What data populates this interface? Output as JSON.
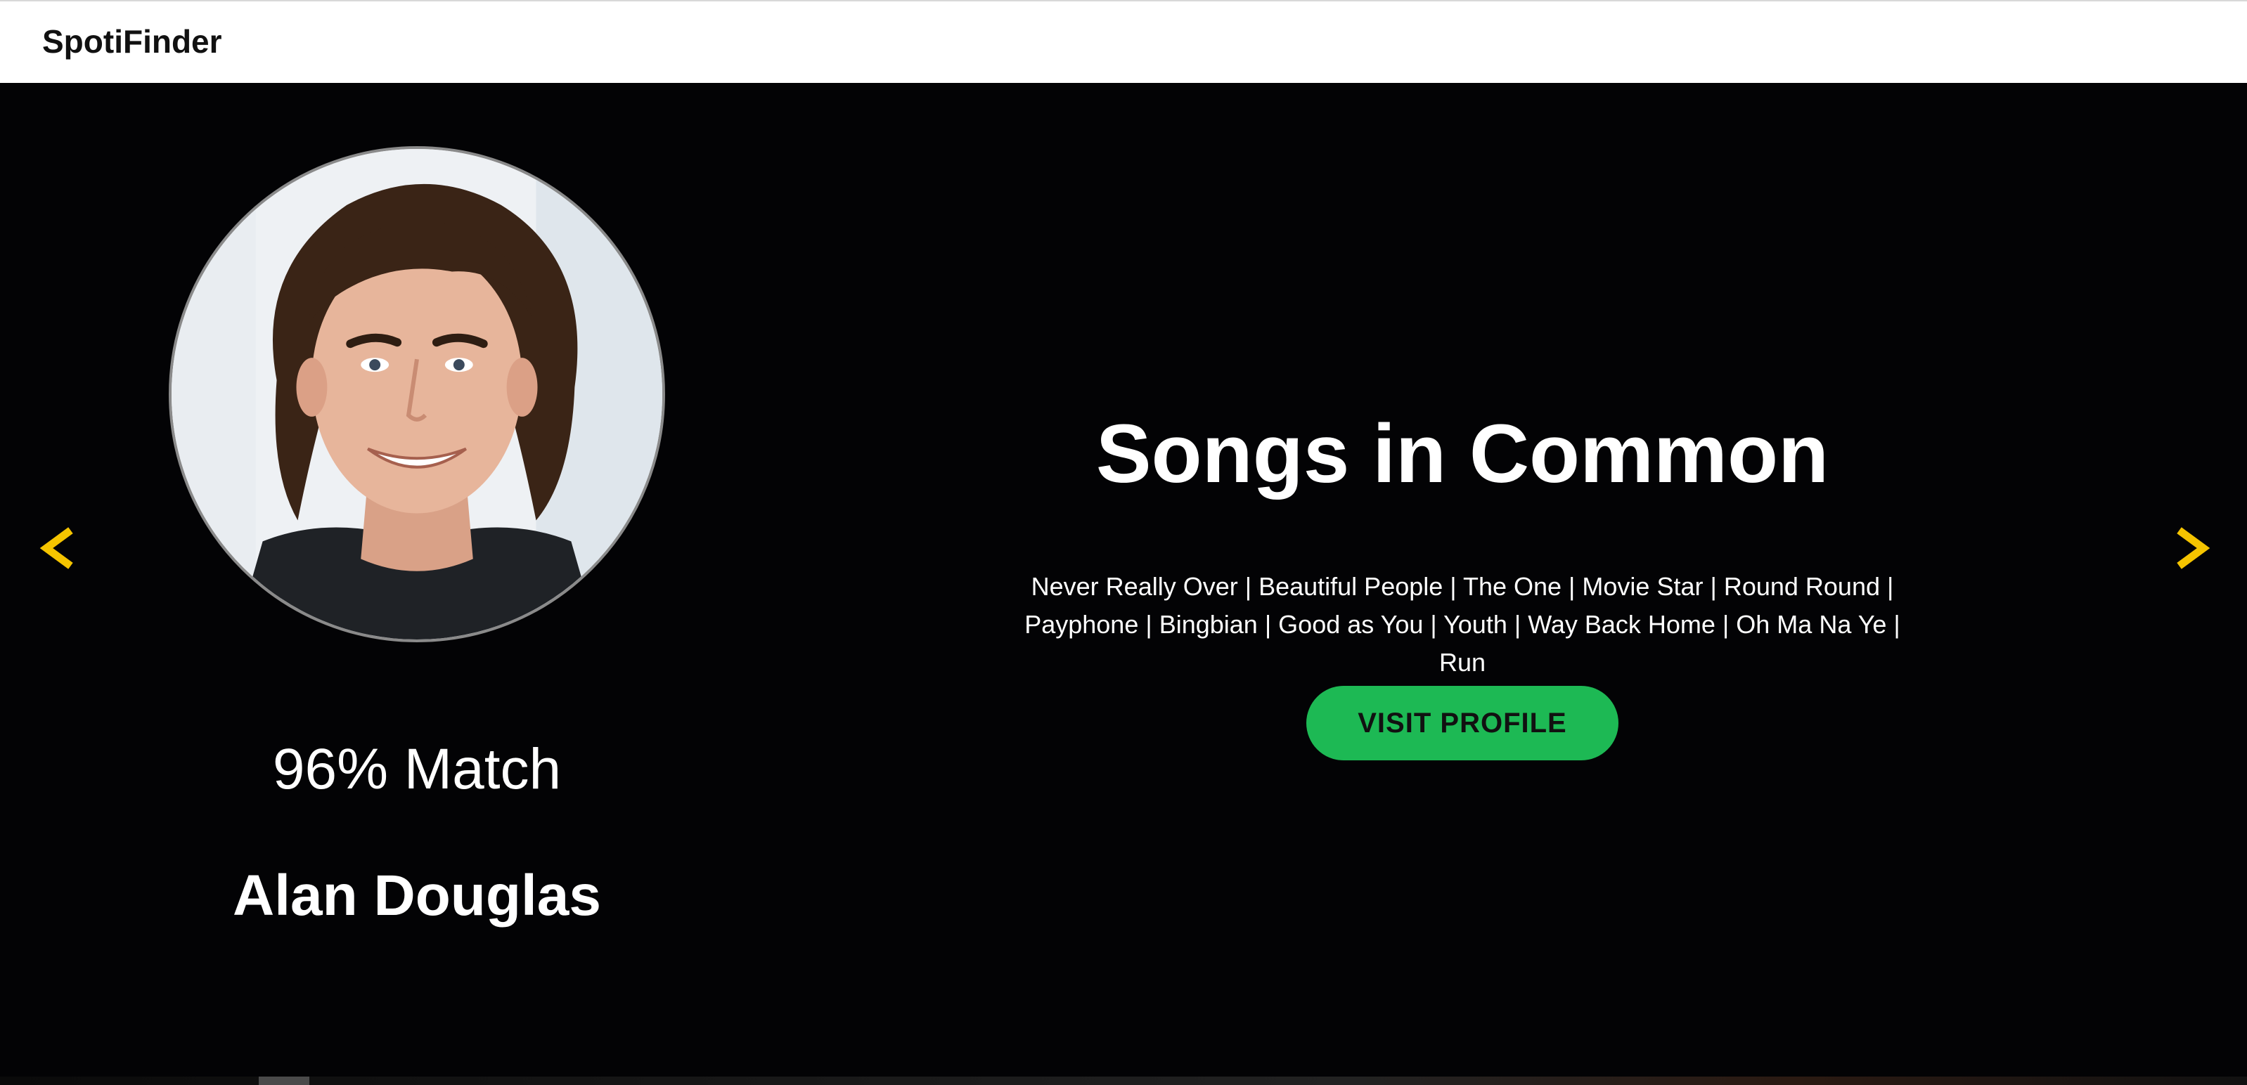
{
  "header": {
    "brand": "SpotiFinder"
  },
  "carousel": {
    "prev_icon": "chevron-left-icon",
    "next_icon": "chevron-right-icon",
    "accent_color": "#f5c400"
  },
  "profile": {
    "match": "96% Match",
    "name": "Alan Douglas"
  },
  "songs": {
    "title": "Songs in Common",
    "list_line1": "Never Really Over | Beautiful People | The One | Movie Star | Round Round |",
    "list_line2": "Payphone | Bingbian | Good as You | Youth | Way Back Home | Oh Ma Na Ye | Run"
  },
  "actions": {
    "visit_label": "VISIT PROFILE",
    "visit_color": "#1db954"
  }
}
